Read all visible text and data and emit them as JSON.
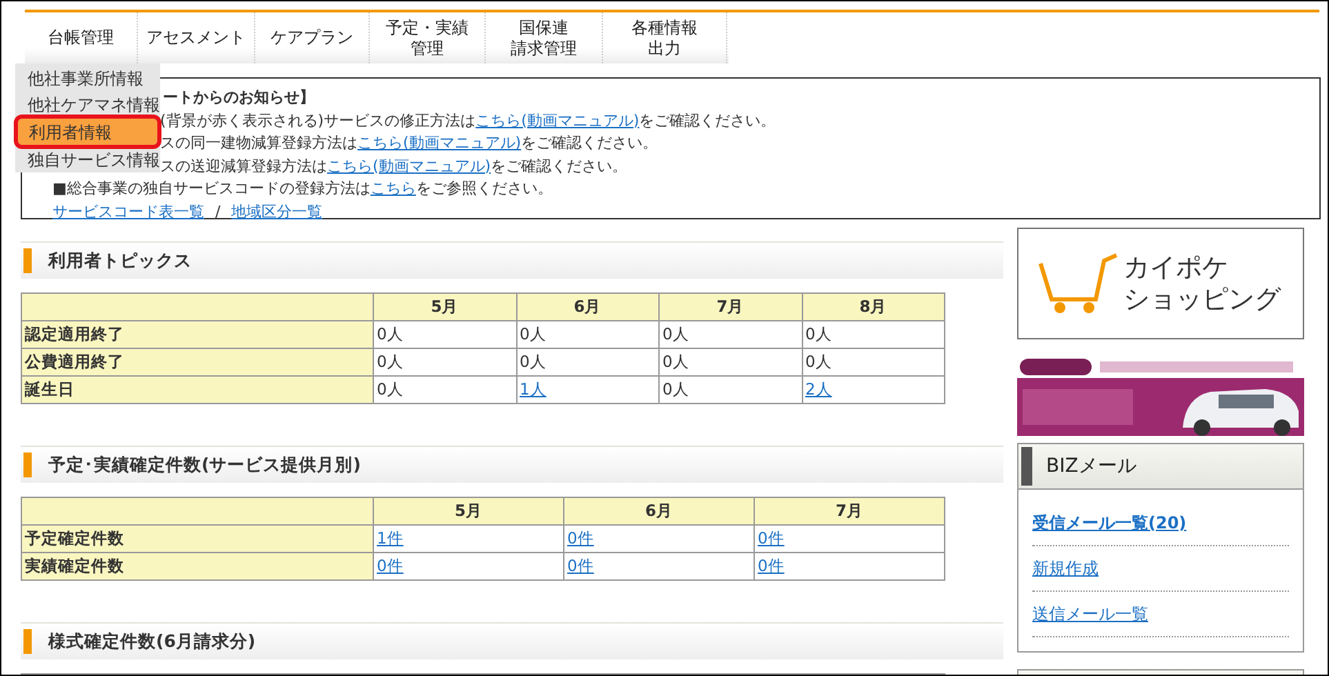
{
  "menu": [
    {
      "lines": [
        "台帳管理"
      ]
    },
    {
      "lines": [
        "アセスメント"
      ]
    },
    {
      "lines": [
        "ケアプラン"
      ]
    },
    {
      "lines": [
        "予定・実績",
        "管理"
      ]
    },
    {
      "lines": [
        "国保連",
        "請求管理"
      ]
    },
    {
      "lines": [
        "各種情報",
        "出力"
      ]
    }
  ],
  "dropdown": [
    {
      "label": "他社事業所情報",
      "selected": false
    },
    {
      "label": "他社ケアマネ情報",
      "selected": false
    },
    {
      "label": "利用者情報",
      "selected": true
    },
    {
      "label": "独自サービス情報",
      "selected": false
    }
  ],
  "notice": {
    "title": "ートからのお知らせ】",
    "lines": [
      {
        "kind": "covered",
        "before": "(背景が赤く表示される)サービスの修正方法は",
        "link": "こちら(動画マニュアル)",
        "after": "をご確認ください。"
      },
      {
        "kind": "covered",
        "before": "スの同一建物減算登録方法は",
        "link": "こちら(動画マニュアル)",
        "after": "をご確認ください。"
      },
      {
        "kind": "covered",
        "before": "スの送迎減算登録方法は",
        "link": "こちら(動画マニュアル)",
        "after": "をご確認ください。"
      },
      {
        "kind": "plain",
        "before": "■総合事業の独自サービスコードの登録方法は",
        "link": "こちら",
        "after": "をご参照ください。"
      }
    ],
    "links": [
      "サービスコード表一覧",
      "地域区分一覧"
    ],
    "separator": "/"
  },
  "sections": [
    {
      "title": "利用者トピックス",
      "table": {
        "columns": [
          "5月",
          "6月",
          "7月",
          "8月"
        ],
        "rows": [
          {
            "label": "認定適用終了",
            "cells": [
              {
                "text": "0人",
                "link": false
              },
              {
                "text": "0人",
                "link": false
              },
              {
                "text": "0人",
                "link": false
              },
              {
                "text": "0人",
                "link": false
              }
            ]
          },
          {
            "label": "公費適用終了",
            "cells": [
              {
                "text": "0人",
                "link": false
              },
              {
                "text": "0人",
                "link": false
              },
              {
                "text": "0人",
                "link": false
              },
              {
                "text": "0人",
                "link": false
              }
            ]
          },
          {
            "label": "誕生日",
            "cells": [
              {
                "text": "0人",
                "link": false
              },
              {
                "text": "1人",
                "link": true
              },
              {
                "text": "0人",
                "link": false
              },
              {
                "text": "2人",
                "link": true
              }
            ]
          }
        ]
      }
    },
    {
      "title": "予定･実績確定件数(サービス提供月別)",
      "table": {
        "columns": [
          "5月",
          "6月",
          "7月"
        ],
        "rows": [
          {
            "label": "予定確定件数",
            "cells": [
              {
                "text": "1件",
                "link": true
              },
              {
                "text": "0件",
                "link": true
              },
              {
                "text": "0件",
                "link": true
              }
            ]
          },
          {
            "label": "実績確定件数",
            "cells": [
              {
                "text": "0件",
                "link": true
              },
              {
                "text": "0件",
                "link": true
              },
              {
                "text": "0件",
                "link": true
              }
            ]
          }
        ]
      }
    },
    {
      "title": "様式確定件数(6月請求分)"
    }
  ],
  "shop_banner": {
    "lines": [
      "カイポケ",
      "ショッピング"
    ]
  },
  "biz_mail": {
    "title": "BIZメール",
    "links": [
      "受信メール一覧(20)",
      "新規作成",
      "送信メール一覧"
    ]
  }
}
